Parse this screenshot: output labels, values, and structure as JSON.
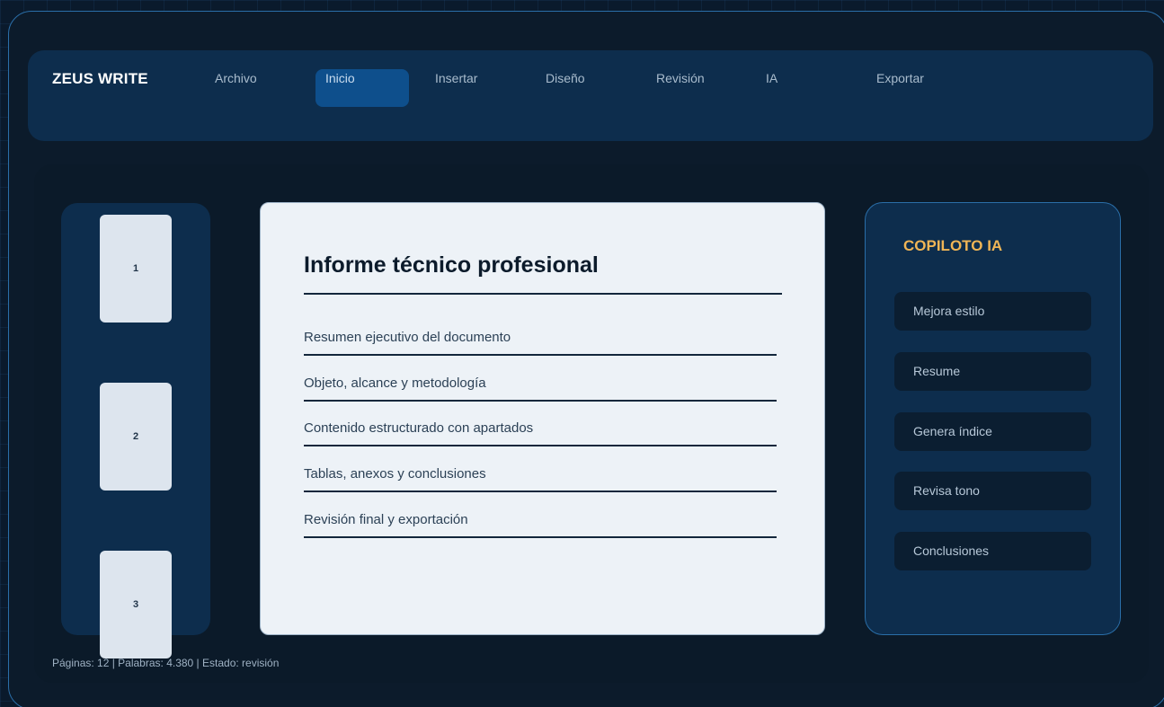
{
  "app": {
    "brand": "ZEUS WRITE"
  },
  "menu": {
    "items": [
      "Archivo",
      "Inicio",
      "Insertar",
      "Diseño",
      "Revisión",
      "IA",
      "Exportar"
    ],
    "active": "Inicio"
  },
  "thumbnails": [
    "1",
    "2",
    "3"
  ],
  "document": {
    "title": "Informe técnico profesional",
    "lines": [
      "Resumen ejecutivo del documento",
      "Objeto, alcance y metodología",
      "Contenido estructurado con apartados",
      "Tablas, anexos y conclusiones",
      "Revisión final y exportación"
    ]
  },
  "copilot": {
    "title": "COPILOTO IA",
    "actions": [
      "Mejora estilo",
      "Resume",
      "Genera índice",
      "Revisa tono",
      "Conclusiones"
    ]
  },
  "status": {
    "text": "Páginas: 12  |  Palabras: 4.380  |  Estado: revisión"
  },
  "colors": {
    "accent": "#0e4f8c",
    "copilot_title": "#f0b556",
    "panel": "#0d2d4d",
    "border": "#2a6ea8"
  }
}
